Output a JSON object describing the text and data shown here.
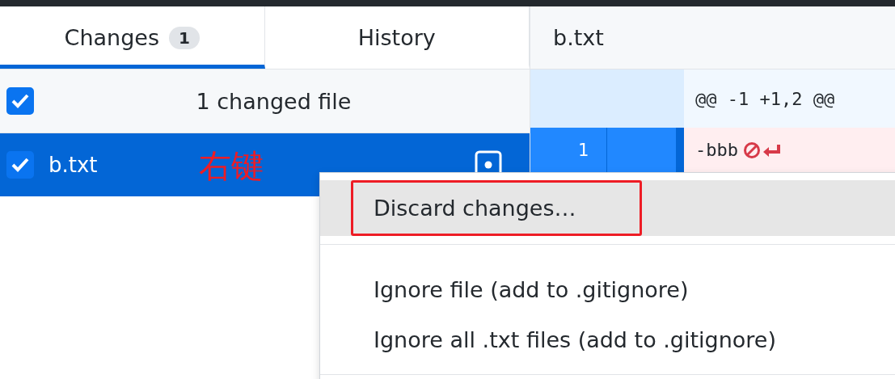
{
  "tabs": [
    {
      "label": "Changes",
      "badge": "1",
      "selected": true
    },
    {
      "label": "History",
      "selected": false
    }
  ],
  "changes_header": {
    "label": "1 changed file",
    "checked": true
  },
  "files": [
    {
      "name": "b.txt",
      "checked": true,
      "selected": true,
      "modified": true
    }
  ],
  "annotation": {
    "text": "右键"
  },
  "diff": {
    "file": "b.txt",
    "hunk": "@@ -1 +1,2 @@",
    "lines": [
      {
        "kind": "deleted",
        "old": "1",
        "text": "-bbb",
        "no_newline": true
      }
    ]
  },
  "context_menu": [
    [
      {
        "label": "Discard changes…",
        "selected": true,
        "framed": true
      }
    ],
    [
      {
        "label": "Ignore file (add to .gitignore)",
        "selected": false,
        "framed": false
      },
      {
        "label": "Ignore all .txt files (add to .gitignore)",
        "selected": false,
        "framed": false
      }
    ]
  ]
}
